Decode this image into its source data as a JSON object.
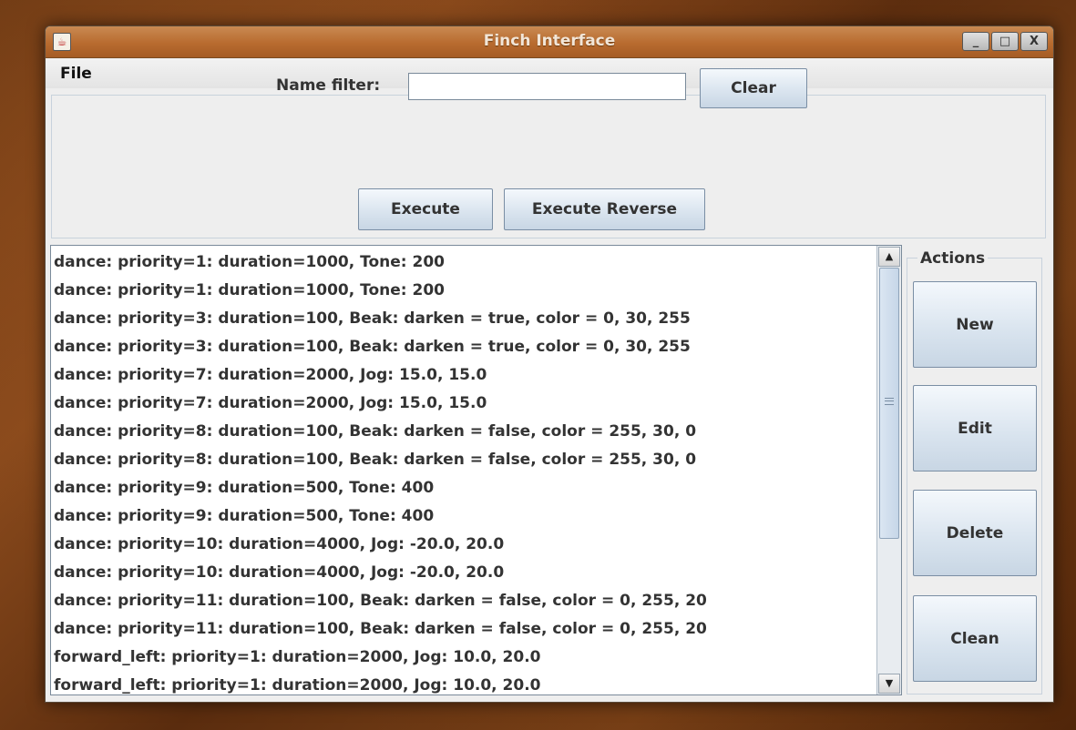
{
  "window": {
    "title": "Finch Interface",
    "app_icon": "java-icon",
    "controls": {
      "minimize": "_",
      "maximize": "□",
      "close": "X"
    }
  },
  "menu": {
    "file": "File"
  },
  "filter": {
    "label": "Name filter:",
    "value": "",
    "clear_label": "Clear"
  },
  "toolbar": {
    "execute_label": "Execute",
    "execute_reverse_label": "Execute Reverse"
  },
  "list": {
    "rows": [
      "dance: priority=1: duration=1000, Tone: 200",
      "dance: priority=1: duration=1000, Tone: 200",
      "dance: priority=3: duration=100, Beak: darken = true, color = 0, 30, 255",
      "dance: priority=3: duration=100, Beak: darken = true, color = 0, 30, 255",
      "dance: priority=7: duration=2000, Jog: 15.0, 15.0",
      "dance: priority=7: duration=2000, Jog: 15.0, 15.0",
      "dance: priority=8: duration=100, Beak: darken = false, color = 255, 30, 0",
      "dance: priority=8: duration=100, Beak: darken = false, color = 255, 30, 0",
      "dance: priority=9: duration=500, Tone: 400",
      "dance: priority=9: duration=500, Tone: 400",
      "dance: priority=10: duration=4000, Jog: -20.0, 20.0",
      "dance: priority=10: duration=4000, Jog: -20.0, 20.0",
      "dance: priority=11: duration=100, Beak: darken = false, color = 0, 255, 20",
      "dance: priority=11: duration=100, Beak: darken = false, color = 0, 255, 20",
      "forward_left: priority=1: duration=2000, Jog: 10.0, 20.0",
      "forward_left: priority=1: duration=2000, Jog: 10.0, 20.0"
    ],
    "scroll_up_icon": "▲",
    "scroll_down_icon": "▼"
  },
  "actions": {
    "title": "Actions",
    "new_label": "New",
    "edit_label": "Edit",
    "delete_label": "Delete",
    "clean_label": "Clean"
  },
  "colors": {
    "titlebar": "#b86b2f",
    "window_bg": "#eeeeee",
    "button_bg": "#d8e3ee",
    "desktop": "#6e3a14"
  }
}
